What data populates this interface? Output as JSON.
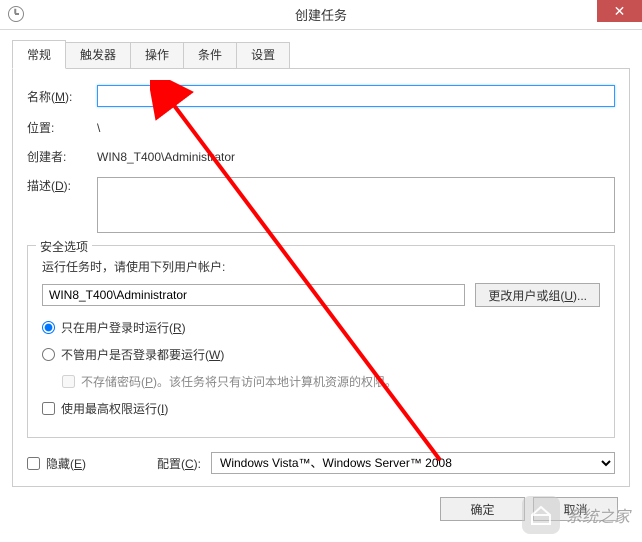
{
  "titlebar": {
    "title": "创建任务"
  },
  "tabs": {
    "items": [
      {
        "label": "常规"
      },
      {
        "label": "触发器"
      },
      {
        "label": "操作"
      },
      {
        "label": "条件"
      },
      {
        "label": "设置"
      }
    ]
  },
  "form": {
    "name": {
      "label_prefix": "名称(",
      "label_key": "M",
      "label_suffix": "):",
      "value": ""
    },
    "location": {
      "label": "位置:",
      "value": "\\"
    },
    "creator": {
      "label": "创建者:",
      "value": "WIN8_T400\\Administrator"
    },
    "description": {
      "label_prefix": "描述(",
      "label_key": "D",
      "label_suffix": "):",
      "value": ""
    }
  },
  "security": {
    "legend": "安全选项",
    "run_as_text": "运行任务时，请使用下列用户帐户:",
    "account_value": "WIN8_T400\\Administrator",
    "change_user_btn_prefix": "更改用户或组(",
    "change_user_btn_key": "U",
    "change_user_btn_suffix": ")...",
    "radio_logged_on_prefix": "只在用户登录时运行(",
    "radio_logged_on_key": "R",
    "radio_logged_on_suffix": ")",
    "radio_any_prefix": "不管用户是否登录都要运行(",
    "radio_any_key": "W",
    "radio_any_suffix": ")",
    "no_store_pw_prefix": "不存储密码(",
    "no_store_pw_key": "P",
    "no_store_pw_suffix": ")。该任务将只有访问本地计算机资源的权限。",
    "highest_priv_prefix": "使用最高权限运行(",
    "highest_priv_key": "I",
    "highest_priv_suffix": ")"
  },
  "bottom": {
    "hidden_prefix": "隐藏(",
    "hidden_key": "E",
    "hidden_suffix": ")",
    "config_label_prefix": "配置(",
    "config_label_key": "C",
    "config_label_suffix": "):",
    "config_value": "Windows Vista™、Windows Server™ 2008"
  },
  "buttons": {
    "ok": "确定",
    "cancel": "取消"
  },
  "watermark": {
    "text": "系统之家"
  }
}
